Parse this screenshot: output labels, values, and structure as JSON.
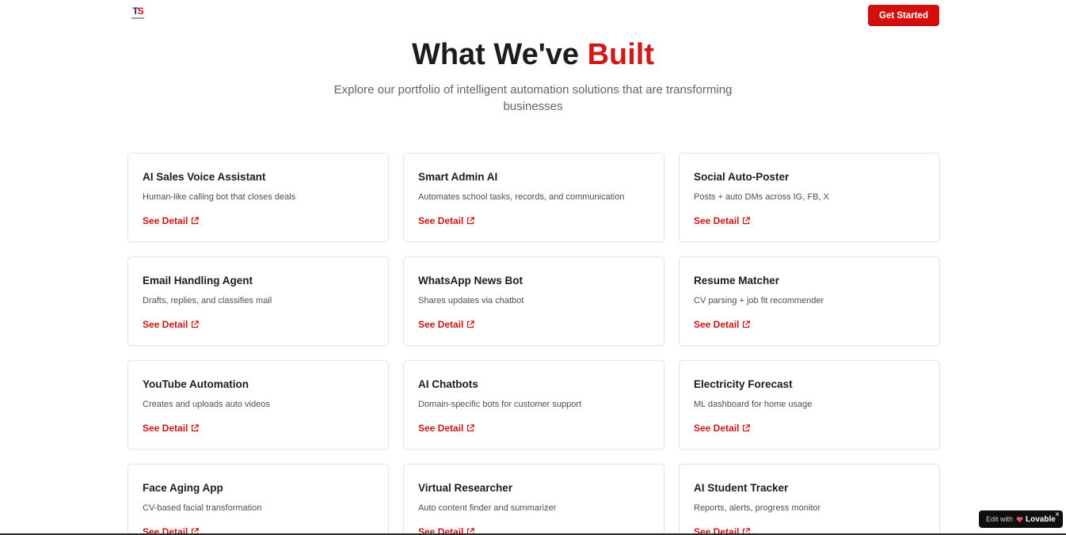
{
  "header": {
    "logo_text": "TS",
    "cta_label": "Get Started",
    "brand_color": "#d20f0f"
  },
  "hero": {
    "title_prefix": "What We've ",
    "title_accent": "Built",
    "subtitle": "Explore our portfolio of intelligent automation solutions that are transforming businesses"
  },
  "link_label": "See Detail",
  "link_icon": "external-link-icon",
  "projects": [
    {
      "title": "AI Sales Voice Assistant",
      "description": "Human-like calling bot that closes deals"
    },
    {
      "title": "Smart Admin AI",
      "description": "Automates school tasks, records, and communication"
    },
    {
      "title": "Social Auto-Poster",
      "description": "Posts + auto DMs across IG, FB, X"
    },
    {
      "title": "Email Handling Agent",
      "description": "Drafts, replies, and classifies mail"
    },
    {
      "title": "WhatsApp News Bot",
      "description": "Shares updates via chatbot"
    },
    {
      "title": "Resume Matcher",
      "description": "CV parsing + job fit recommender"
    },
    {
      "title": "YouTube Automation",
      "description": "Creates and uploads auto videos"
    },
    {
      "title": "AI Chatbots",
      "description": "Domain-specific bots for customer support"
    },
    {
      "title": "Electricity Forecast",
      "description": "ML dashboard for home usage"
    },
    {
      "title": "Face Aging App",
      "description": "CV-based facial transformation"
    },
    {
      "title": "Virtual Researcher",
      "description": "Auto content finder and summarizer"
    },
    {
      "title": "AI Student Tracker",
      "description": "Reports, alerts, progress monitor"
    }
  ],
  "badge": {
    "edit_text": "Edit with",
    "brand": "Lovable",
    "close": "×"
  }
}
